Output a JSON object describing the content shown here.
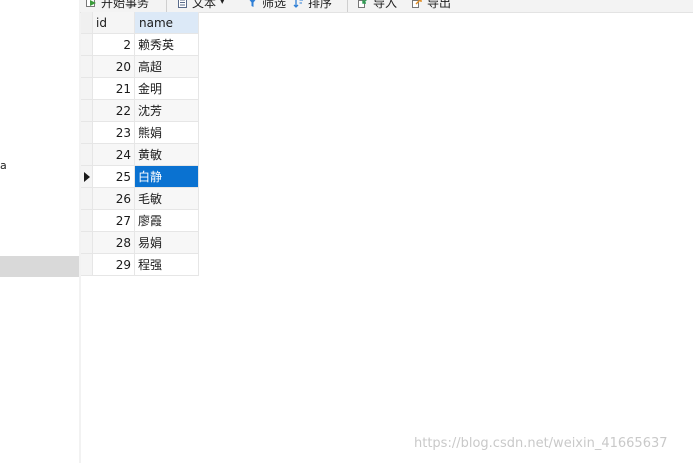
{
  "toolbar": {
    "items": [
      {
        "label": "开始事务",
        "icon": "begin-transaction-icon",
        "color": "#3a9b3a"
      },
      {
        "label": "文本",
        "icon": "text-icon",
        "color": "#5a6b8a"
      },
      {
        "label": "筛选",
        "icon": "filter-icon",
        "color": "#2f7fd6"
      },
      {
        "label": "排序",
        "icon": "sort-icon",
        "color": "#2f7fd6"
      },
      {
        "label": "导入",
        "icon": "import-icon",
        "color": "#2e9b52"
      },
      {
        "label": "导出",
        "icon": "export-icon",
        "color": "#e08a1e"
      }
    ],
    "text_dropdown_arrow": "▾"
  },
  "left_panel": {
    "fragment_text": "a"
  },
  "grid": {
    "columns": [
      "id",
      "name"
    ],
    "current_row_index": 6,
    "rows": [
      {
        "id": "2",
        "name": "赖秀英"
      },
      {
        "id": "20",
        "name": "高超"
      },
      {
        "id": "21",
        "name": "金明"
      },
      {
        "id": "22",
        "name": "沈芳"
      },
      {
        "id": "23",
        "name": "熊娟"
      },
      {
        "id": "24",
        "name": "黄敏"
      },
      {
        "id": "25",
        "name": "白静"
      },
      {
        "id": "26",
        "name": "毛敏"
      },
      {
        "id": "27",
        "name": "廖霞"
      },
      {
        "id": "28",
        "name": "易娟"
      },
      {
        "id": "29",
        "name": "程强"
      }
    ]
  },
  "watermark": "https://blog.csdn.net/weixin_41665637",
  "colors": {
    "selection": "#0a72d1",
    "header_active": "#dce9f7"
  }
}
